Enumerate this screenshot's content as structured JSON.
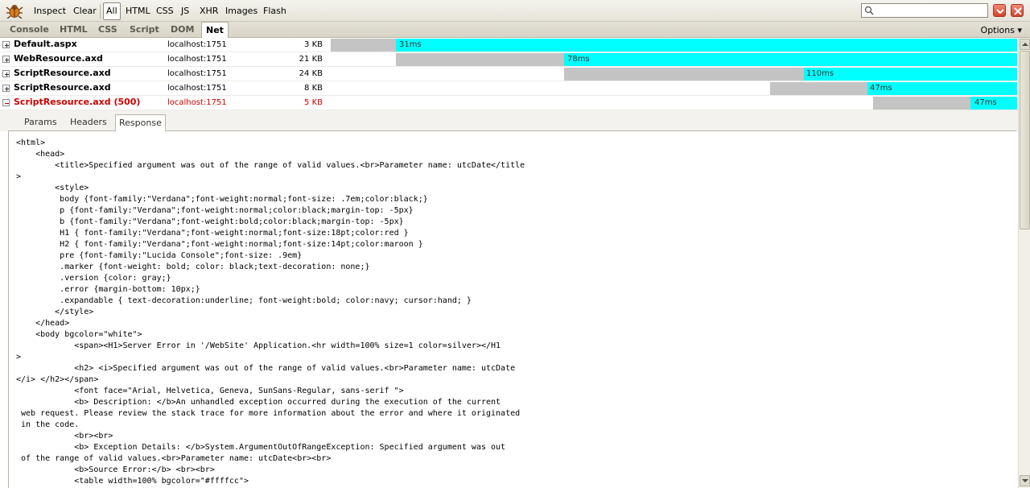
{
  "toolbar": {
    "inspect_label": "Inspect",
    "clear_label": "Clear",
    "filters": [
      "All",
      "HTML",
      "CSS",
      "JS",
      "XHR",
      "Images",
      "Flash"
    ],
    "active_filter": "All",
    "search_value": ""
  },
  "panel_tabs": [
    "Console",
    "HTML",
    "CSS",
    "Script",
    "DOM",
    "Net"
  ],
  "active_panel": "Net",
  "options_label": "Options ▾",
  "requests": [
    {
      "name": "Default.aspx",
      "host": "localhost:1751",
      "size": "3 KB",
      "time": "31ms",
      "expanded": false,
      "error": false
    },
    {
      "name": "WebResource.axd",
      "host": "localhost:1751",
      "size": "21 KB",
      "time": "78ms",
      "expanded": false,
      "error": false
    },
    {
      "name": "ScriptResource.axd",
      "host": "localhost:1751",
      "size": "24 KB",
      "time": "110ms",
      "expanded": false,
      "error": false
    },
    {
      "name": "ScriptResource.axd",
      "host": "localhost:1751",
      "size": "8 KB",
      "time": "47ms",
      "expanded": false,
      "error": false
    },
    {
      "name": "ScriptResource.axd (500)",
      "host": "localhost:1751",
      "size": "5 KB",
      "time": "47ms",
      "expanded": true,
      "error": true
    }
  ],
  "detail_tabs": [
    "Params",
    "Headers",
    "Response"
  ],
  "active_detail_tab": "Response",
  "response_lines": [
    "<html>",
    "    <head>",
    "        <title>Specified argument was out of the range of valid values.<br>Parameter name: utcDate</title",
    ">",
    "        <style>",
    "         body {font-family:\"Verdana\";font-weight:normal;font-size: .7em;color:black;}",
    "         p {font-family:\"Verdana\";font-weight:normal;color:black;margin-top: -5px}",
    "         b {font-family:\"Verdana\";font-weight:bold;color:black;margin-top: -5px}",
    "         H1 { font-family:\"Verdana\";font-weight:normal;font-size:18pt;color:red }",
    "         H2 { font-family:\"Verdana\";font-weight:normal;font-size:14pt;color:maroon }",
    "         pre {font-family:\"Lucida Console\";font-size: .9em}",
    "         .marker {font-weight: bold; color: black;text-decoration: none;}",
    "         .version {color: gray;}",
    "         .error {margin-bottom: 10px;}",
    "         .expandable { text-decoration:underline; font-weight:bold; color:navy; cursor:hand; }",
    "        </style>",
    "    </head>",
    "    <body bgcolor=\"white\">",
    "            <span><H1>Server Error in '/WebSite' Application.<hr width=100% size=1 color=silver></H1",
    ">",
    "            <h2> <i>Specified argument was out of the range of valid values.<br>Parameter name: utcDate",
    "</i> </h2></span>",
    "            <font face=\"Arial, Helvetica, Geneva, SunSans-Regular, sans-serif \">",
    "            <b> Description: </b>An unhandled exception occurred during the execution of the current",
    " web request. Please review the stack trace for more information about the error and where it originated",
    " in the code.",
    "            <br><br>",
    "            <b> Exception Details: </b>System.ArgumentOutOfRangeException: Specified argument was out",
    " of the range of valid values.<br>Parameter name: utcDate<br><br>",
    "            <b>Source Error:</b> <br><br>",
    "            <table width=100% bgcolor=\"#ffffcc\">"
  ],
  "colors": {
    "load_bar": "#00ffff",
    "wait_bar": "#c4c4c4",
    "error_text": "#cc0000"
  }
}
